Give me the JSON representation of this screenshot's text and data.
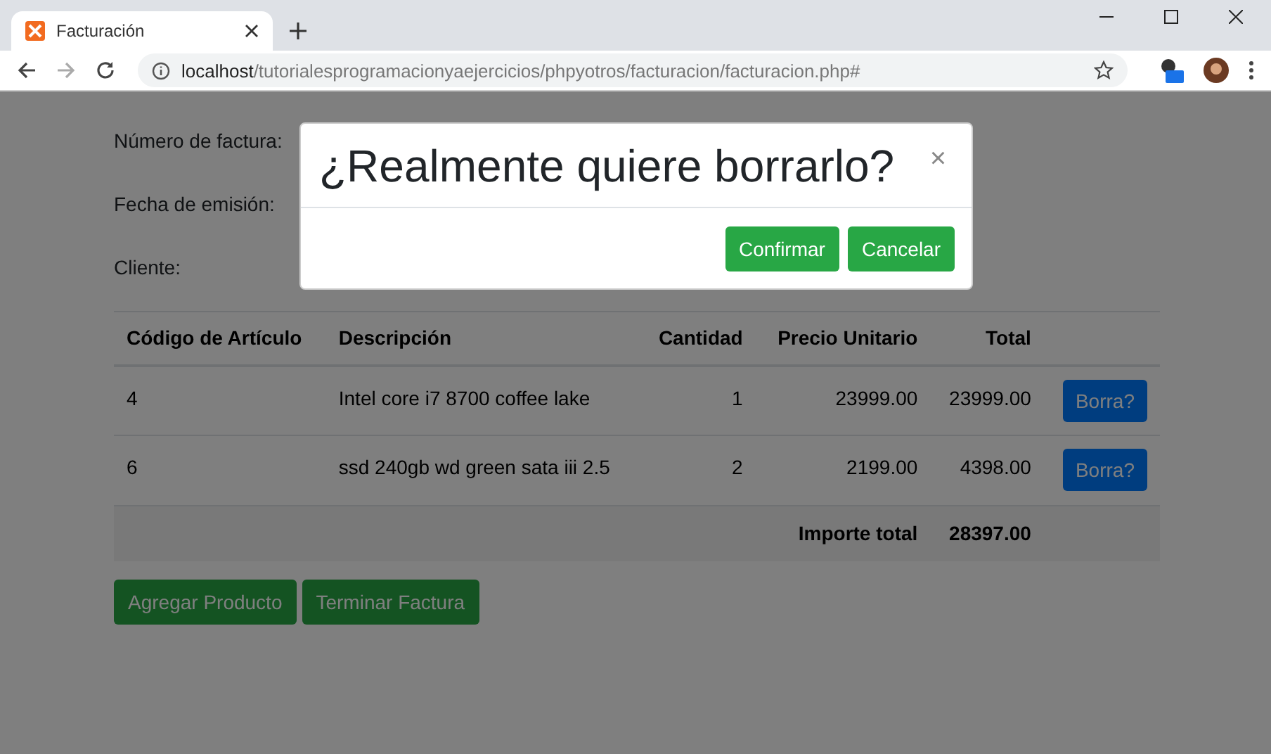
{
  "browser": {
    "tab": {
      "title": "Facturación",
      "selected": true
    },
    "address": {
      "host": "localhost",
      "path": "/tutorialesprogramacionyaejercicios/phpyotros/facturacion/facturacion.php#"
    }
  },
  "form": {
    "fields": [
      {
        "label": "Número de factura:"
      },
      {
        "label": "Fecha de emisión:"
      },
      {
        "label": "Cliente:"
      }
    ]
  },
  "table": {
    "columns": [
      {
        "label": "Código de Artículo",
        "kind": "text"
      },
      {
        "label": "Descripción",
        "kind": "text"
      },
      {
        "label": "Cantidad",
        "kind": "number"
      },
      {
        "label": "Precio Unitario",
        "kind": "number"
      },
      {
        "label": "Total",
        "kind": "number"
      }
    ],
    "rows": [
      {
        "cells": [
          "4",
          "Intel core i7 8700 coffee lake",
          "1",
          "23999.00",
          "23999.00"
        ],
        "action": "Borra?"
      },
      {
        "cells": [
          "6",
          "ssd 240gb wd green sata iii 2.5",
          "2",
          "2199.00",
          "4398.00"
        ],
        "action": "Borra?"
      }
    ],
    "total": {
      "label": "Importe total",
      "value": "28397.00"
    }
  },
  "buttons": [
    "Agregar Producto",
    "Terminar Factura"
  ],
  "modal": {
    "title": "¿Realmente quiere borrarlo?",
    "close": "×",
    "buttons": [
      {
        "label": "Confirmar",
        "kind": "success"
      },
      {
        "label": "Cancelar",
        "kind": "success"
      }
    ]
  }
}
